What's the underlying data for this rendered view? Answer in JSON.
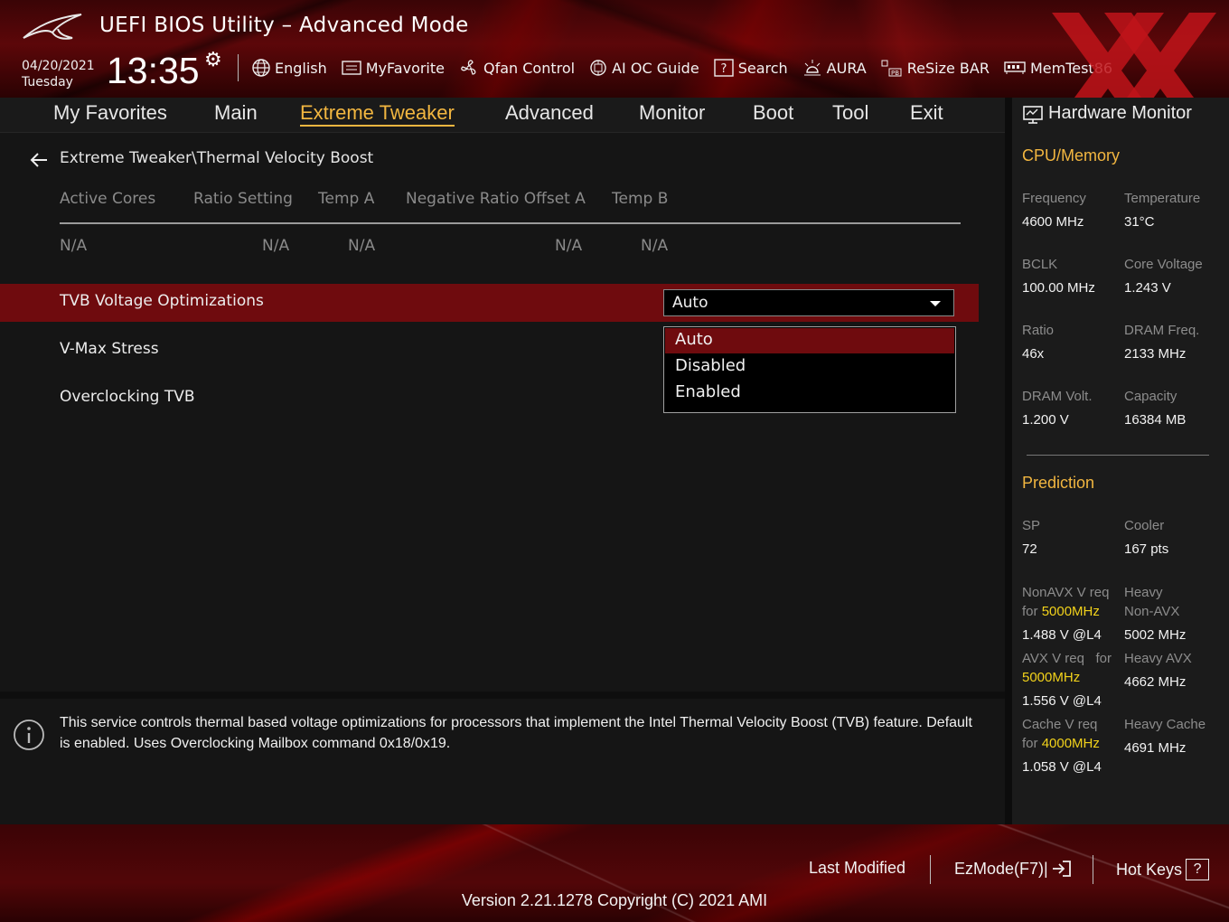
{
  "header": {
    "title": "UEFI BIOS Utility – Advanced Mode",
    "date": "04/20/2021",
    "day": "Tuesday",
    "time": "13:35",
    "toolbar": [
      {
        "label": "English",
        "icon": "globe-icon"
      },
      {
        "label": "MyFavorite",
        "icon": "favorite-list-icon"
      },
      {
        "label": "Qfan Control",
        "icon": "fan-icon"
      },
      {
        "label": "AI OC Guide",
        "icon": "ai-chip-icon"
      },
      {
        "label": "Search",
        "icon": "question-box-icon"
      },
      {
        "label": "AURA",
        "icon": "aura-light-icon"
      },
      {
        "label": "ReSize BAR",
        "icon": "resize-bar-icon"
      },
      {
        "label": "MemTest86",
        "icon": "memtest-icon"
      }
    ]
  },
  "menu": {
    "items": [
      "My Favorites",
      "Main",
      "Extreme Tweaker",
      "Advanced",
      "Monitor",
      "Boot",
      "Tool",
      "Exit"
    ],
    "active": "Extreme Tweaker"
  },
  "main": {
    "breadcrumb": "Extreme Tweaker\\Thermal Velocity Boost",
    "tvb_table": {
      "headers": [
        "Active Cores",
        "Ratio Setting",
        "Temp A",
        "Negative Ratio Offset A",
        "Temp B"
      ],
      "values": [
        "N/A",
        "N/A",
        "N/A",
        "N/A",
        "N/A"
      ]
    },
    "rows": [
      {
        "label": "TVB Voltage Optimizations",
        "value": "Auto",
        "selected": true
      },
      {
        "label": "V-Max Stress"
      },
      {
        "label": "Overclocking TVB"
      }
    ],
    "dropdown": {
      "options": [
        "Auto",
        "Disabled",
        "Enabled"
      ],
      "selected": "Auto"
    }
  },
  "help": {
    "text": "This service controls thermal based voltage optimizations for processors that implement the Intel Thermal Velocity Boost (TVB) feature. Default is enabled. Uses Overclocking Mailbox command 0x18/0x19."
  },
  "hw_monitor": {
    "title": "Hardware Monitor",
    "cpu_memory": {
      "title": "CPU/Memory",
      "frequency_label": "Frequency",
      "frequency": "4600 MHz",
      "temperature_label": "Temperature",
      "temperature": "31°C",
      "bclk_label": "BCLK",
      "bclk": "100.00 MHz",
      "core_voltage_label": "Core Voltage",
      "core_voltage": "1.243 V",
      "ratio_label": "Ratio",
      "ratio": "46x",
      "dram_freq_label": "DRAM Freq.",
      "dram_freq": "2133 MHz",
      "dram_volt_label": "DRAM Volt.",
      "dram_volt": "1.200 V",
      "capacity_label": "Capacity",
      "capacity": "16384 MB"
    },
    "prediction": {
      "title": "Prediction",
      "sp_label": "SP",
      "sp": "72",
      "cooler_label": "Cooler",
      "cooler": "167 pts",
      "nonavx_label": "NonAVX V req",
      "nonavx_for": "for",
      "nonavx_freq": "5000MHz",
      "nonavx_value": "1.488 V @L4",
      "heavy_nonavx_label_1": "Heavy",
      "heavy_nonavx_label_2": "Non-AVX",
      "heavy_nonavx_value": "5002 MHz",
      "avx_label": "AVX V req",
      "avx_for": "for",
      "avx_freq": "5000MHz",
      "avx_value": "1.556 V @L4",
      "heavy_avx_label": "Heavy AVX",
      "heavy_avx_value": "4662 MHz",
      "cache_label": "Cache V req",
      "cache_for": "for",
      "cache_freq": "4000MHz",
      "cache_value": "1.058 V @L4",
      "heavy_cache_label": "Heavy Cache",
      "heavy_cache_value": "4691 MHz"
    }
  },
  "footer": {
    "last_modified": "Last Modified",
    "ezmode": "EzMode(F7)|",
    "hotkeys": "Hot Keys",
    "hotkeys_key": "?",
    "version": "Version 2.21.1278 Copyright (C) 2021 AMI"
  },
  "colors": {
    "accent": "#f2b640",
    "highlight_row": "#6f0b0e",
    "freq_highlight": "#f2d21b",
    "brand_red": "#c0141a"
  }
}
